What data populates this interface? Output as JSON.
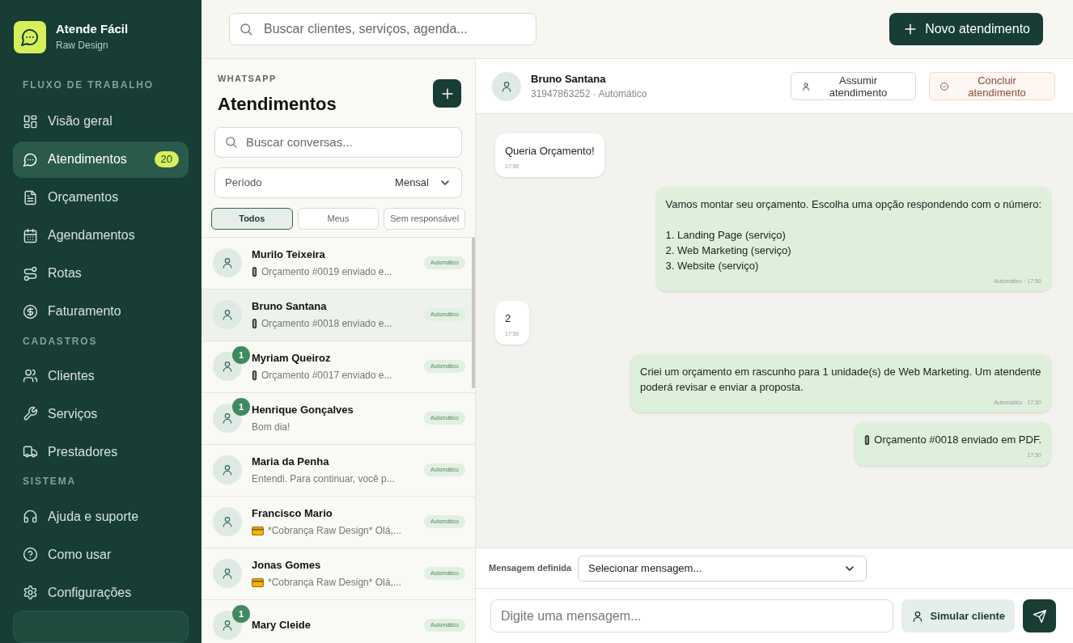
{
  "brand": {
    "name": "Atende Fácil",
    "subtitle": "Raw Design"
  },
  "sidebar": {
    "sections": [
      {
        "title": "FLUXO DE TRABALHO",
        "items": [
          {
            "label": "Visão geral",
            "selected": false
          },
          {
            "label": "Atendimentos",
            "selected": true,
            "badge": "20"
          },
          {
            "label": "Orçamentos",
            "selected": false
          },
          {
            "label": "Agendamentos",
            "selected": false
          },
          {
            "label": "Rotas",
            "selected": false
          },
          {
            "label": "Faturamento",
            "selected": false
          }
        ]
      },
      {
        "title": "CADASTROS",
        "items": [
          {
            "label": "Clientes",
            "selected": false
          },
          {
            "label": "Serviços",
            "selected": false
          },
          {
            "label": "Prestadores",
            "selected": false
          }
        ]
      },
      {
        "title": "SISTEMA",
        "items": [
          {
            "label": "Ajuda e suporte",
            "selected": false
          },
          {
            "label": "Como usar",
            "selected": false
          },
          {
            "label": "Configurações",
            "selected": false
          }
        ]
      }
    ]
  },
  "topbar": {
    "search_placeholder": "Buscar clientes, serviços, agenda...",
    "new_button": "Novo atendimento"
  },
  "list": {
    "eyebrow": "WHATSAPP",
    "title": "Atendimentos",
    "search_placeholder": "Buscar conversas...",
    "period_label": "Período",
    "period_value": "Mensal",
    "filters": [
      {
        "label": "Todos",
        "selected": true
      },
      {
        "label": "Meus",
        "selected": false
      },
      {
        "label": "Sem responsável",
        "selected": false
      }
    ],
    "conversations": [
      {
        "kind": "attachment",
        "name": "Murilo Teixeira",
        "preview": "Orçamento #0019 enviado e...",
        "tag": "Automático",
        "selected": false
      },
      {
        "kind": "attachment",
        "name": "Bruno Santana",
        "preview": "Orçamento #0018 enviado e...",
        "tag": "Automático",
        "selected": true
      },
      {
        "kind": "attachment",
        "name": "Myriam Queiroz",
        "preview": "Orçamento #0017 enviado e...",
        "tag": "Automático",
        "unread": "1",
        "selected": false
      },
      {
        "kind": "text",
        "name": "Henrique Gonçalves",
        "preview": "Bom dia!",
        "tag": "Automático",
        "unread": "1",
        "selected": false
      },
      {
        "kind": "text",
        "name": "Maria da Penha",
        "preview": "Entendi. Para continuar, você p...",
        "tag": "Automático",
        "selected": false
      },
      {
        "kind": "billing",
        "name": "Francisco Mario",
        "preview": "*Cobrança Raw Design* Olá,...",
        "tag": "Automático",
        "selected": false
      },
      {
        "kind": "billing",
        "name": "Jonas Gomes",
        "preview": "*Cobrança Raw Design* Olá,...",
        "tag": "Automático",
        "selected": false
      },
      {
        "name": "Mary Cleide",
        "tag": "Automático",
        "unread": "1",
        "selected": false
      }
    ]
  },
  "chat": {
    "contact": "Bruno Santana",
    "contact_info": "31947863252 · Automático",
    "assume_button": "Assumir atendimento",
    "close_button": "Concluir atendimento",
    "messages": [
      {
        "kind": "in",
        "text": "Queria Orçamento!",
        "meta": "17:50"
      },
      {
        "kind": "out",
        "text": "Vamos montar seu orçamento. Escolha uma opção respondendo com o número:\n\n1. Landing Page (serviço)\n2. Web Marketing (serviço)\n3. Website (serviço)",
        "meta": "Automático · 17:50"
      },
      {
        "kind": "in",
        "text": "2",
        "meta": "17:50"
      },
      {
        "kind": "out",
        "text": "Criei um orçamento em rascunho para 1 unidade(s) de Web Marketing. Um atendente poderá revisar e enviar a proposta.",
        "meta": "Automático · 17:50"
      },
      {
        "kind": "out_attachment",
        "text": "Orçamento #0018 enviado em PDF.",
        "meta": "17:50"
      }
    ],
    "preset_label": "Mensagem definida",
    "preset_placeholder": "Selecionar mensagem...",
    "input_placeholder": "Digite uma mensagem...",
    "simulate_button": "Simular cliente"
  }
}
